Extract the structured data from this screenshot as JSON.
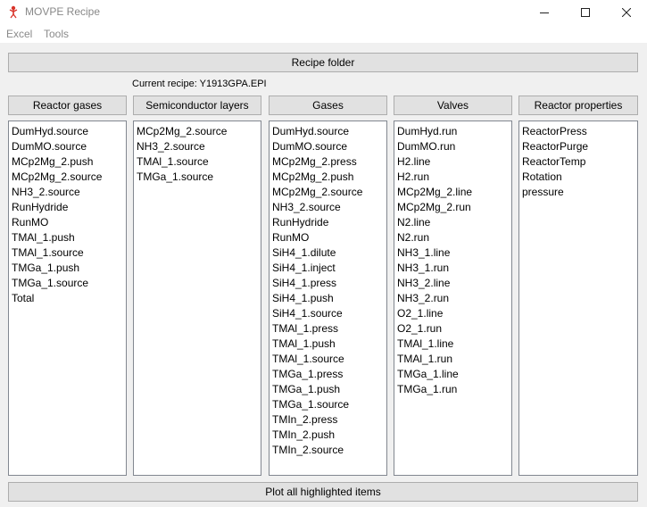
{
  "window": {
    "title": "MOVPE Recipe"
  },
  "menu": {
    "items": [
      "Excel",
      "Tools"
    ]
  },
  "recipe_folder_label": "Recipe folder",
  "current_recipe_label": "Current recipe: Y1913GPA.EPI",
  "plot_button_label": "Plot all highlighted items",
  "columns": [
    {
      "header": "Reactor gases",
      "items": [
        "DumHyd.source",
        "DumMO.source",
        "MCp2Mg_2.push",
        "MCp2Mg_2.source",
        "NH3_2.source",
        "RunHydride",
        "RunMO",
        "TMAl_1.push",
        "TMAl_1.source",
        "TMGa_1.push",
        "TMGa_1.source",
        "Total"
      ]
    },
    {
      "header": "Semiconductor layers",
      "items": [
        "MCp2Mg_2.source",
        "NH3_2.source",
        "TMAl_1.source",
        "TMGa_1.source"
      ]
    },
    {
      "header": "Gases",
      "items": [
        "DumHyd.source",
        "DumMO.source",
        "MCp2Mg_2.press",
        "MCp2Mg_2.push",
        "MCp2Mg_2.source",
        "NH3_2.source",
        "RunHydride",
        "RunMO",
        "SiH4_1.dilute",
        "SiH4_1.inject",
        "SiH4_1.press",
        "SiH4_1.push",
        "SiH4_1.source",
        "TMAl_1.press",
        "TMAl_1.push",
        "TMAl_1.source",
        "TMGa_1.press",
        "TMGa_1.push",
        "TMGa_1.source",
        "TMIn_2.press",
        "TMIn_2.push",
        "TMIn_2.source"
      ]
    },
    {
      "header": "Valves",
      "items": [
        "DumHyd.run",
        "DumMO.run",
        "H2.line",
        "H2.run",
        "MCp2Mg_2.line",
        "MCp2Mg_2.run",
        "N2.line",
        "N2.run",
        "NH3_1.line",
        "NH3_1.run",
        "NH3_2.line",
        "NH3_2.run",
        "O2_1.line",
        "O2_1.run",
        "TMAl_1.line",
        "TMAl_1.run",
        "TMGa_1.line",
        "TMGa_1.run"
      ]
    },
    {
      "header": "Reactor properties",
      "items": [
        "ReactorPress",
        "ReactorPurge",
        "ReactorTemp",
        "Rotation",
        "pressure"
      ]
    }
  ]
}
